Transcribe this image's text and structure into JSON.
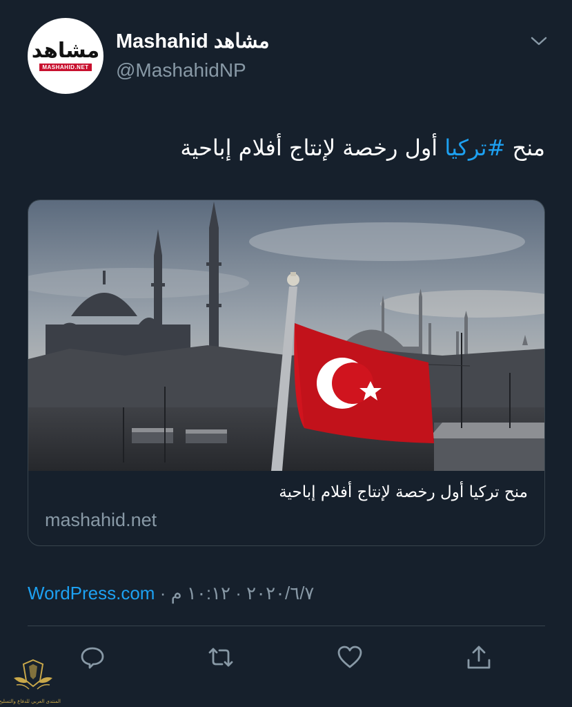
{
  "tweet": {
    "author": {
      "display_name": "Mashahid مشاهد",
      "handle": "@MashahidNP",
      "avatar_logo_ar": "مشاهد",
      "avatar_logo_en": "MASHAHID.NET"
    },
    "text_prefix": "منح ",
    "hashtag": "#تركيا",
    "text_suffix": " أول رخصة لإنتاج أفلام إباحية",
    "card": {
      "title": "منح تركيا أول رخصة لإنتاج أفلام إباحية",
      "domain": "mashahid.net"
    },
    "meta": {
      "time": "١٠:١٢ م",
      "date": "٢٠٢٠/٦/٧",
      "separator": "·",
      "source": "WordPress.com"
    },
    "actions": [
      {
        "icon": "reply-icon"
      },
      {
        "icon": "retweet-icon"
      },
      {
        "icon": "like-icon"
      },
      {
        "icon": "share-icon"
      }
    ]
  },
  "watermark": {
    "text": "المنتدى العربي للدفاع والتسليح"
  },
  "colors": {
    "background": "#16202c",
    "text": "#ffffff",
    "secondary": "#8899a6",
    "accent": "#1da1f2",
    "border": "#38444d",
    "flag_red": "#d0141e"
  }
}
